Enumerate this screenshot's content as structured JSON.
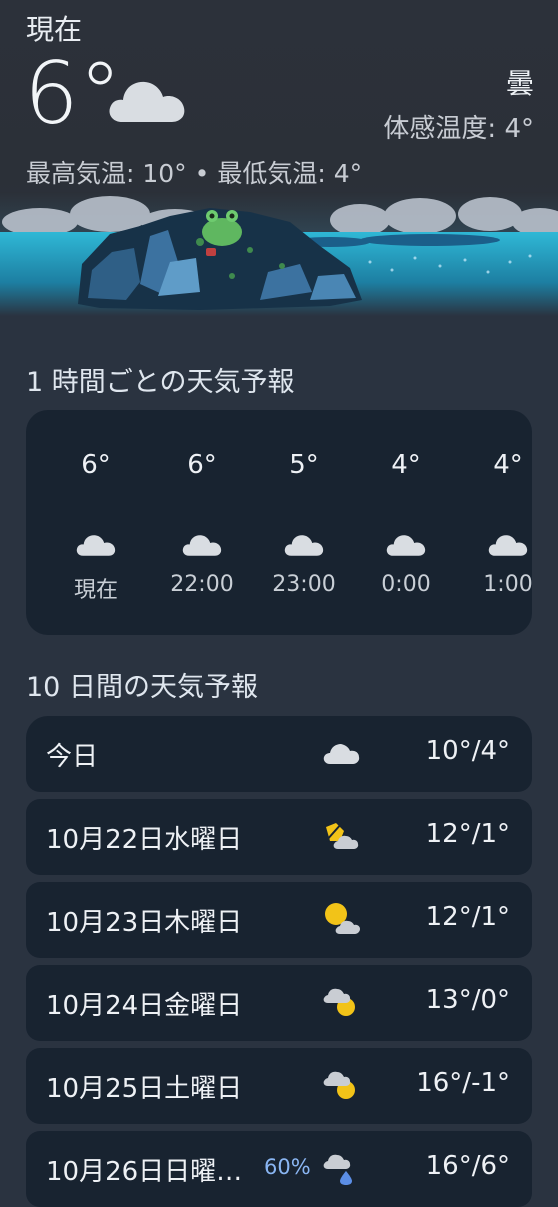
{
  "current": {
    "label": "現在",
    "temperature": "6°",
    "condition": "曇",
    "feels_like": "体感温度: 4°",
    "high_low": "最高気温: 10° • 最低気温: 4°",
    "icon": "cloud-icon"
  },
  "hourly": {
    "title": "1 時間ごとの天気予報",
    "items": [
      {
        "temp": "6°",
        "time": "現在",
        "icon": "cloud-icon"
      },
      {
        "temp": "6°",
        "time": "22:00",
        "icon": "cloud-icon"
      },
      {
        "temp": "5°",
        "time": "23:00",
        "icon": "cloud-icon"
      },
      {
        "temp": "4°",
        "time": "0:00",
        "icon": "cloud-icon"
      },
      {
        "temp": "4°",
        "time": "1:00",
        "icon": "cloud-icon"
      }
    ]
  },
  "daily": {
    "title": "10 日間の天気予報",
    "items": [
      {
        "day": "今日",
        "temps": "10°/4°",
        "icon": "cloud-icon",
        "precip": ""
      },
      {
        "day": "10月22日水曜日",
        "temps": "12°/1°",
        "icon": "partly-cloudy-icon",
        "precip": ""
      },
      {
        "day": "10月23日木曜日",
        "temps": "12°/1°",
        "icon": "sun-cloud-icon",
        "precip": ""
      },
      {
        "day": "10月24日金曜日",
        "temps": "13°/0°",
        "icon": "cloud-sun-icon",
        "precip": ""
      },
      {
        "day": "10月25日土曜日",
        "temps": "16°/-1°",
        "icon": "cloud-sun-icon",
        "precip": ""
      },
      {
        "day": "10月26日日曜…",
        "temps": "16°/6°",
        "icon": "rain-cloud-icon",
        "precip": "60%"
      }
    ]
  },
  "colors": {
    "background": "#2a3340",
    "card": "#182330",
    "precip": "#8ab6f3",
    "sun": "#f2c318"
  }
}
